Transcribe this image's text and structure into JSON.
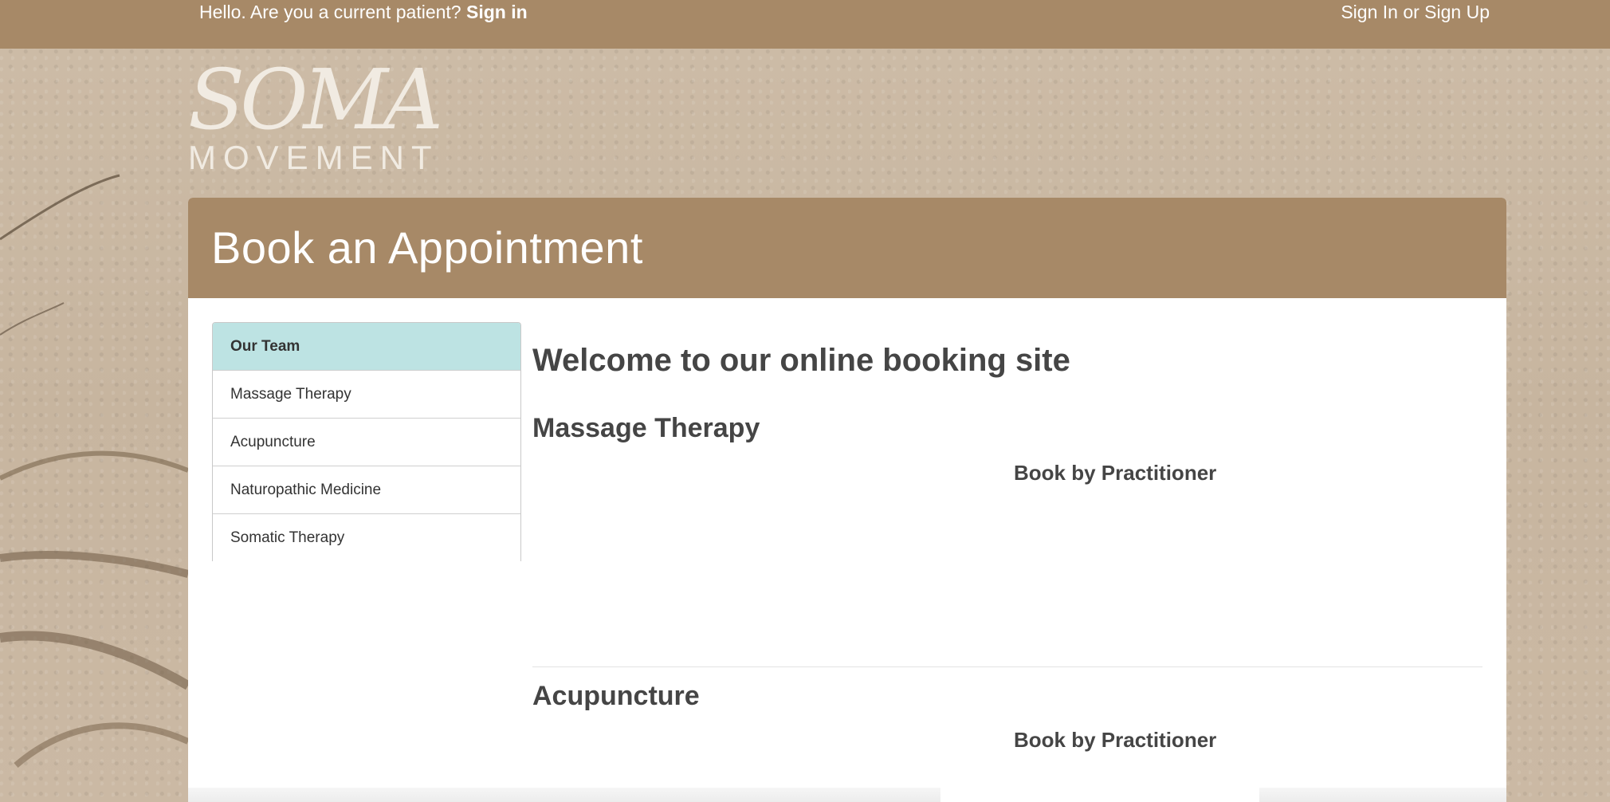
{
  "topbar": {
    "greeting": "Hello. Are you a current patient?",
    "signin_link": "Sign in",
    "auth_link": "Sign In or Sign Up"
  },
  "logo": {
    "wordmark": "SOMA",
    "subtitle": "MOVEMENT"
  },
  "panel": {
    "title": "Book an Appointment"
  },
  "sidenav": {
    "items": [
      {
        "label": "Our Team",
        "active": true
      },
      {
        "label": "Massage Therapy"
      },
      {
        "label": "Acupuncture"
      },
      {
        "label": "Naturopathic Medicine"
      },
      {
        "label": "Somatic Therapy"
      }
    ]
  },
  "content": {
    "welcome": "Welcome to our online booking site",
    "sections": [
      {
        "title": "Massage Therapy",
        "subheading": "Book by Practitioner"
      },
      {
        "title": "Acupuncture",
        "subheading": "Book by Practitioner"
      }
    ]
  },
  "colors": {
    "brand": "#a78967",
    "active_nav": "#bde3e3",
    "text": "#454545"
  }
}
